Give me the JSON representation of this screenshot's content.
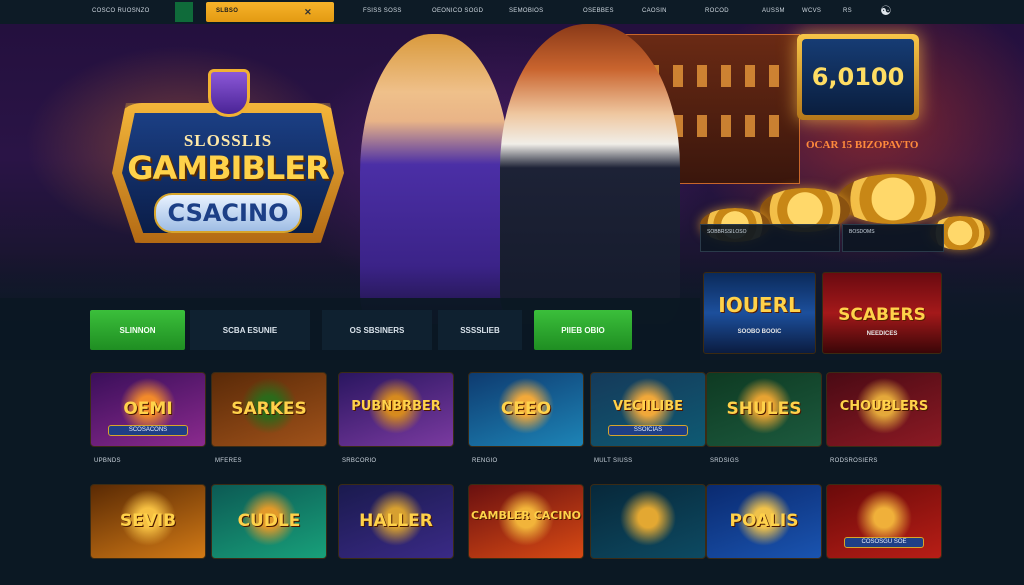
{
  "topnav": {
    "brand": "COSCO RUOSNZO",
    "search": {
      "label": "SLBSO",
      "clear": "✕"
    },
    "links": [
      "FSISS SOSS",
      "OEONICO SOGD",
      "SEMOBIOS",
      "OSEBBES",
      "CAOSIN",
      "ROCOD",
      "AUSSM",
      "WCVS",
      "RS"
    ],
    "user_icon": "person-icon"
  },
  "hero": {
    "logo": {
      "top": "SLOSSLIS",
      "main": "GAMBIBLER",
      "casino": "CSACINO"
    },
    "bonus": "6,0100",
    "tagline": "OCAR 15 BIZOPAVTO",
    "panels": [
      "SOBBRSSILOSO",
      "BOSDOMS"
    ]
  },
  "filters": [
    {
      "label": "SLINNON",
      "style": "green"
    },
    {
      "label": "SCBA ESUNIE",
      "style": "dark"
    },
    {
      "label": "OS SBSINERS",
      "style": "dark"
    },
    {
      "label": "SSSSLIEB",
      "style": "dark"
    },
    {
      "label": "PIIEB OBIO",
      "style": "green"
    }
  ],
  "featured": [
    {
      "title": "IOUERL",
      "sub": "SOOBO BOOIC"
    },
    {
      "title": "SCABERS",
      "sub": "NEEDICES"
    }
  ],
  "games_row1": [
    {
      "name": "OEMI",
      "sub": "SCOSACONS",
      "caption": "UPBNDS",
      "colors": [
        "#3a0f5a",
        "#8b2a8e",
        "#f28a2a"
      ]
    },
    {
      "name": "SARKES",
      "sub": "",
      "caption": "MFERES",
      "colors": [
        "#5a2a08",
        "#a0521a",
        "#2c6a1a"
      ]
    },
    {
      "name": "PUBNBRBER",
      "sub": "",
      "caption": "SRBCORIO",
      "colors": [
        "#2a1660",
        "#7a3aa0",
        "#d68a1e"
      ]
    },
    {
      "name": "CEEO",
      "sub": "",
      "caption": "RENGIO",
      "colors": [
        "#0e3b70",
        "#1d84b6",
        "#f2a93a"
      ]
    },
    {
      "name": "VECIILIBE",
      "sub": "SSOICIAS",
      "caption": "MULT SIUSS",
      "colors": [
        "#153a5a",
        "#0e5a73",
        "#f0a83a"
      ]
    },
    {
      "name": "SHULES",
      "sub": "",
      "caption": "SRDSIGS",
      "colors": [
        "#0e3a22",
        "#1c5a3e",
        "#e6a332"
      ]
    },
    {
      "name": "CHOUBLERS",
      "sub": "",
      "caption": "RODSROSIERS",
      "colors": [
        "#4a0a14",
        "#8c1a24",
        "#e4a83a"
      ]
    }
  ],
  "games_row2": [
    {
      "name": "SEVIB",
      "sub": "",
      "colors": [
        "#5a2a04",
        "#d27a16",
        "#f6c042"
      ]
    },
    {
      "name": "CUDLE",
      "sub": "",
      "colors": [
        "#0c5a54",
        "#18a07a",
        "#e29a2a"
      ]
    },
    {
      "name": "HALLER",
      "sub": "",
      "colors": [
        "#1a1a4e",
        "#3a2a86",
        "#d7a030"
      ]
    },
    {
      "name": "CAMBLER CACINO",
      "sub": "",
      "colors": [
        "#6a1010",
        "#d84a14",
        "#f2b43a"
      ]
    },
    {
      "name": "",
      "sub": "",
      "colors": [
        "#07283a",
        "#0d4a62",
        "#e3a832"
      ]
    },
    {
      "name": "POALIS",
      "sub": "",
      "colors": [
        "#0a2a70",
        "#1a54b0",
        "#f0c24a"
      ]
    },
    {
      "name": "",
      "sub": "COSOSGU SOE",
      "colors": [
        "#6a0a0a",
        "#b81e16",
        "#f0b03a"
      ]
    }
  ]
}
